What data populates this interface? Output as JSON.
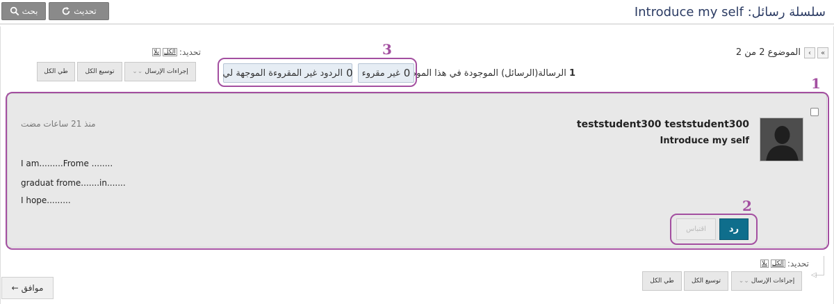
{
  "header": {
    "search_label": "بحث",
    "refresh_label": "تحديث",
    "title": "سلسلة رسائل: Introduce my self"
  },
  "nav": {
    "topic_position": "الموضوع 2 من 2",
    "first_icon": "double-chevron-icon",
    "prev_icon": "chevron-left-icon"
  },
  "selection": {
    "label": "تحديد:",
    "all": "الكل",
    "none": "بلا"
  },
  "toolbar": {
    "thread_actions": "إجراءات الإرسال",
    "expand_all": "توسيع الكل",
    "collapse_all": "طي الكل"
  },
  "stats": {
    "count": "1",
    "messages_text": "الرسالة(الرسائل) الموجودة في هذا الموضوع",
    "unread_count": "0",
    "unread_label": "غير مقروء",
    "unread_replies_count": "0",
    "unread_replies_label": "الردود غير المقروءة الموجهة لي"
  },
  "annotations": {
    "one": "1",
    "two": "2",
    "three": "3",
    "color": "#a34fa0"
  },
  "message": {
    "author": "teststudent300 teststudent300",
    "subject": "Introduce my self",
    "timestamp": "منذ 21 ساعات مضت",
    "body_lines": [
      "I am.........Frome ........",
      "graduat frome.......in.......",
      "I hope........."
    ],
    "reply_label": "رد",
    "quote_label": "اقتباس"
  },
  "footer": {
    "ok_label": "موافق"
  },
  "colors": {
    "reply_button": "#0f6e8c",
    "title": "#2b3b63",
    "pill_bg": "#e6edf4"
  }
}
